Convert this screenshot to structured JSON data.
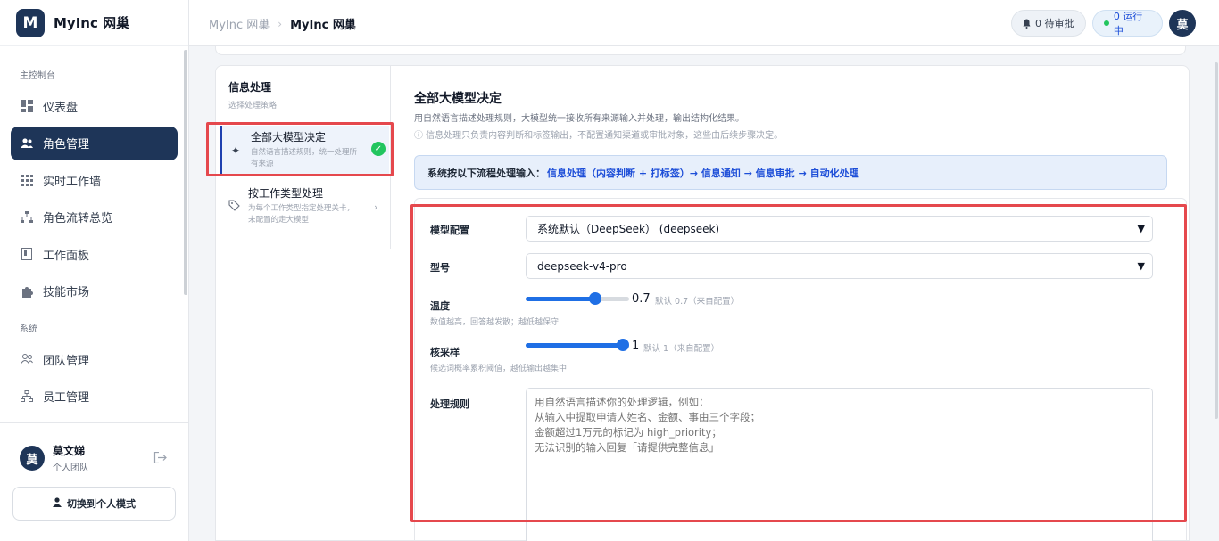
{
  "sidebar": {
    "brand": {
      "logo_letter": "M",
      "name": "MyInc 网巢"
    },
    "section_main": "主控制台",
    "section_system": "系统",
    "items": [
      {
        "label": "仪表盘",
        "icon": "dashboard-icon"
      },
      {
        "label": "角色管理",
        "icon": "users-icon",
        "active": true
      },
      {
        "label": "实时工作墙",
        "icon": "grid-icon"
      },
      {
        "label": "角色流转总览",
        "icon": "flow-icon"
      },
      {
        "label": "工作面板",
        "icon": "board-icon"
      },
      {
        "label": "技能市场",
        "icon": "puzzle-icon"
      },
      {
        "label": "团队管理",
        "icon": "team-icon"
      },
      {
        "label": "员工管理",
        "icon": "org-icon"
      }
    ],
    "user": {
      "avatar": "莫",
      "name": "莫文娣",
      "team": "个人团队"
    },
    "switch_label": "切换到个人模式"
  },
  "topbar": {
    "breadcrumb_parent": "MyInc 网巢",
    "breadcrumb_sep": "›",
    "breadcrumb_current": "MyInc 网巢",
    "pending_label": "0 待审批",
    "running_label": "0 运行中",
    "avatar": "莫"
  },
  "strategy": {
    "title": "信息处理",
    "subtitle": "选择处理策略",
    "options": [
      {
        "title": "全部大模型决定",
        "desc": "自然语言描述规则，统一处理所有来源",
        "selected": true
      },
      {
        "title": "按工作类型处理",
        "desc": "为每个工作类型指定处理关卡，未配置的走大模型",
        "selected": false
      }
    ]
  },
  "config": {
    "title": "全部大模型决定",
    "desc": "用自然语言描述处理规则，大模型统一接收所有来源输入并处理，输出结构化结果。",
    "note": "ⓘ 信息处理只负责内容判断和标签输出，不配置通知渠道或审批对象，这些由后续步骤决定。",
    "flow_lead": "系统按以下流程处理输入：",
    "flow_steps": "信息处理（内容判断 + 打标签）→ 信息通知 → 信息审批 → 自动化处理",
    "model_config_label": "模型配置",
    "model_config_value": "系统默认（DeepSeek） (deepseek)",
    "model_label": "型号",
    "model_value": "deepseek-v4-pro",
    "temperature_label": "温度",
    "temperature_hint": "数值越高，回答越发散；越低越保守",
    "temperature_value": "0.7",
    "temperature_fraction": 0.7,
    "temperature_default": "默认 0.7（来自配置）",
    "top_p_label": "核采样",
    "top_p_hint": "候选词概率累积阈值，越低输出越集中",
    "top_p_value": "1",
    "top_p_fraction": 1,
    "top_p_default": "默认 1（来自配置）",
    "rules_label": "处理规则",
    "rules_placeholder": "用自然语言描述你的处理逻辑，例如：\n从输入中提取申请人姓名、金额、事由三个字段；\n金额超过1万元的标记为 high_priority；\n无法识别的输入回复「请提供完整信息」"
  },
  "colors": {
    "brand": "#1e3558",
    "accent": "#1f6fe5",
    "highlight": "#e5484d",
    "success": "#22c55e"
  }
}
